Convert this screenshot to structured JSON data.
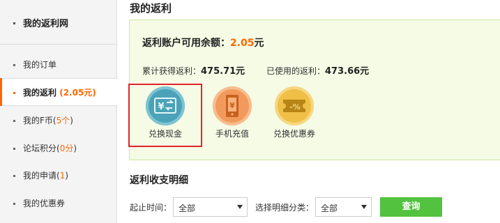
{
  "sidebar": {
    "header": "我的返利网",
    "items": [
      {
        "label": "我的订单",
        "extra": ""
      },
      {
        "label": "我的返利",
        "extra": "(2.05元)",
        "active": true
      },
      {
        "label": "我的F币",
        "extra_open": "(",
        "extra_value": "5个",
        "extra_close": ")"
      },
      {
        "label": "论坛积分",
        "extra_open": "(",
        "extra_value": "0分",
        "extra_close": ")"
      },
      {
        "label": "我的申请",
        "extra_open": "(",
        "extra_value": "1",
        "extra_close": ")"
      },
      {
        "label": "我的优惠券",
        "extra": ""
      }
    ]
  },
  "main": {
    "title": "我的返利",
    "balance": {
      "label": "返利账户可用余额：",
      "amount": "2.05",
      "unit": "元"
    },
    "earned": {
      "label": "累计获得返利：",
      "value": "475.71元"
    },
    "used": {
      "label": "已使用的返利：",
      "value": "473.66元"
    },
    "options": [
      {
        "label": "兑换现金",
        "icon": "cash-exchange-icon",
        "color": "#4aa3b8",
        "selected": true
      },
      {
        "label": "手机充值",
        "icon": "phone-recharge-icon",
        "color": "#f29a5c"
      },
      {
        "label": "兑换优惠券",
        "icon": "coupon-icon",
        "color": "#efbf47"
      }
    ],
    "details_title": "返利收支明细",
    "filters": {
      "date_label": "起止时间：",
      "date_value": "全部",
      "category_label": "选择明细分类：",
      "category_value": "全部",
      "query_label": "查询"
    }
  },
  "colors": {
    "accent": "#ff6600",
    "panel_bg": "#f5fbe5",
    "button": "#52c23f",
    "highlight_frame": "#e2242b"
  }
}
